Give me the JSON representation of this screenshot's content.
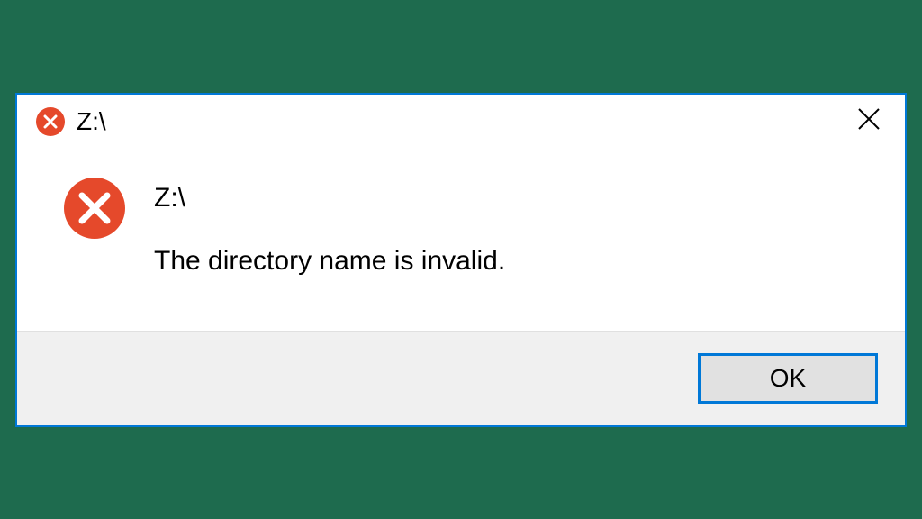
{
  "dialog": {
    "title": "Z:\\",
    "heading": "Z:\\",
    "message": "The directory name is invalid.",
    "ok_label": "OK"
  }
}
